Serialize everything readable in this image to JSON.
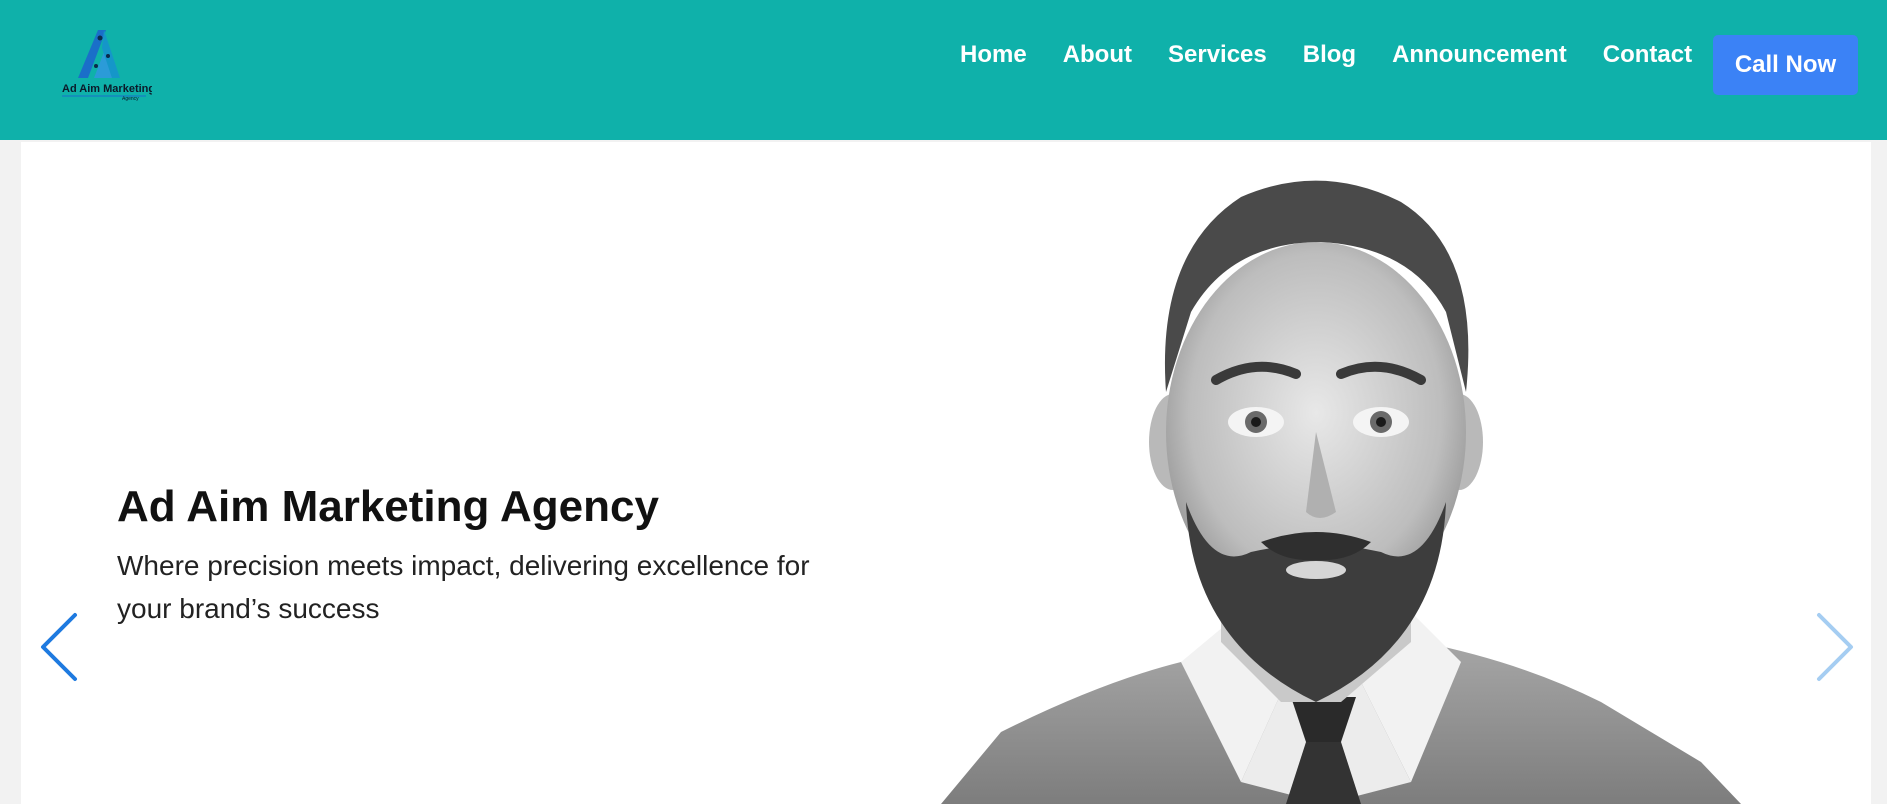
{
  "brand": {
    "logo_text": "Ad Aim Marketing",
    "logo_small_text": "Agency"
  },
  "nav": {
    "items": [
      {
        "label": "Home"
      },
      {
        "label": "About"
      },
      {
        "label": "Services"
      },
      {
        "label": "Blog"
      },
      {
        "label": "Announcement"
      },
      {
        "label": "Contact"
      }
    ],
    "cta_label": "Call Now"
  },
  "hero": {
    "title": "Ad Aim Marketing Agency",
    "subtitle": "Where precision meets impact, delivering excellence for your brand’s success",
    "image_alt": "Black and white portrait of a bearded man in a shirt, tie and knit vest"
  },
  "carousel": {
    "prev_icon": "chevron-left-icon",
    "next_icon": "chevron-right-icon"
  },
  "colors": {
    "header_bg": "#0fb1aa",
    "cta_bg": "#3b82f6",
    "arrow_prev": "#1e7ae0",
    "arrow_next": "#a5cdf2"
  }
}
